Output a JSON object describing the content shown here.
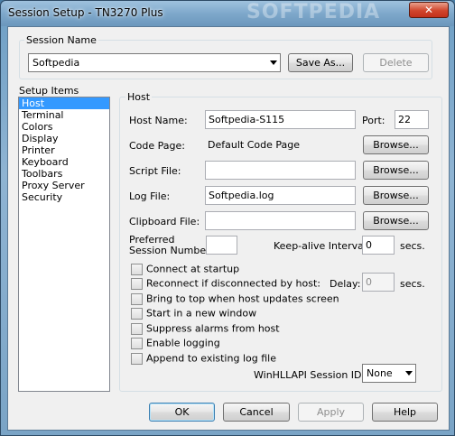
{
  "window": {
    "title": "Session Setup - TN3270 Plus",
    "close_label": "✕",
    "watermark": "SOFTPEDIA"
  },
  "session_name": {
    "label": "Session Name",
    "selected": "Softpedia",
    "save_as_label": "Save As...",
    "delete_label": "Delete"
  },
  "setup_items": {
    "label": "Setup Items",
    "items": [
      "Host",
      "Terminal",
      "Colors",
      "Display",
      "Printer",
      "Keyboard",
      "Toolbars",
      "Proxy Server",
      "Security"
    ],
    "selected_index": 0
  },
  "host": {
    "group_label": "Host",
    "host_name_label": "Host Name:",
    "host_name_value": "Softpedia-S115",
    "port_label": "Port:",
    "port_value": "22",
    "code_page_label": "Code Page:",
    "code_page_value": "Default Code Page",
    "script_file_label": "Script File:",
    "script_file_value": "",
    "log_file_label": "Log File:",
    "log_file_value": "Softpedia.log",
    "clipboard_file_label": "Clipboard File:",
    "clipboard_file_value": "",
    "browse_label": "Browse...",
    "preferred_label_1": "Preferred",
    "preferred_label_2": "Session Number:",
    "preferred_value": "",
    "keepalive_label": "Keep-alive Interval:",
    "keepalive_value": "0",
    "keepalive_unit": "secs.",
    "delay_label": "Delay:",
    "delay_value": "0",
    "delay_unit": "secs.",
    "options": [
      "Connect at startup",
      "Reconnect if disconnected by host:",
      "Bring to top when host updates screen",
      "Start in a new window",
      "Suppress alarms from host",
      "Enable logging",
      "Append to existing log file"
    ],
    "winhllapi_label": "WinHLLAPI Session ID:",
    "winhllapi_value": "None"
  },
  "footer": {
    "ok_label": "OK",
    "cancel_label": "Cancel",
    "apply_label": "Apply",
    "help_label": "Help"
  }
}
